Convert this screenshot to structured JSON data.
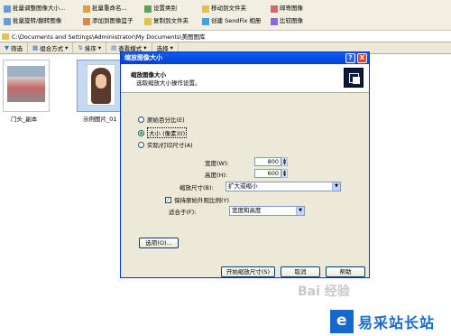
{
  "menu": {
    "row1": [
      "批量调整图像大小...",
      "批量重命名...",
      "设置类别",
      "移动到文件夹",
      "邮寄图像"
    ],
    "row2": [
      "批量旋转/翻转图像",
      "添加到图像篮子",
      "复制到文件夹",
      "创建 SendFix 相册",
      "比较图像"
    ]
  },
  "address": "C:\\Documents and Settings\\Administrator\\My Documents\\美图图库",
  "toolbar": [
    "筛选",
    "组合方式",
    "排序",
    "查看模式",
    "选择"
  ],
  "thumbnails": [
    {
      "caption": "门头_副本"
    },
    {
      "caption": "示例图片_01"
    }
  ],
  "dialog": {
    "title": "缩放图像大小",
    "help_glyph": "?",
    "close_glyph": "X",
    "header_title": "缩放图像大小",
    "header_subtitle": "选取缩放大小操作设置。",
    "opt_percent": "原始百分比(E)",
    "opt_pixels": "大小 (像素)(I)",
    "opt_print": "实际/打印尺寸(A)",
    "width_label": "宽度(W):",
    "width_value": "800",
    "height_label": "高度(H):",
    "height_value": "600",
    "resize_label": "缩放尺寸(B):",
    "resize_value": "扩大或缩小",
    "keep_ratio": "保持原始外观比例(Y)",
    "fit_label": "适合于(F):",
    "fit_value": "宽度和高度",
    "options_button": "选项(O)...",
    "start_button": "开始缩放尺寸(S)",
    "cancel_button": "取消",
    "help_button": "帮助"
  },
  "watermark": "Bai 经验",
  "logo_text": "易采站长站"
}
